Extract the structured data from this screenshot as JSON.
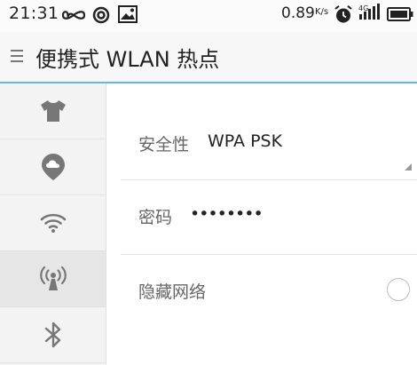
{
  "status_bar": {
    "time": "21:31",
    "speed": "0.89",
    "speed_unit": "K/s",
    "icons": [
      "infinity-icon",
      "sync-icon",
      "image-icon",
      "alarm-icon",
      "signal-4g-icon",
      "battery-icon"
    ],
    "signal_label": "4G"
  },
  "title_bar": {
    "title": "便携式 WLAN 热点",
    "menu_icon": "menu-icon"
  },
  "sidebar": {
    "items": [
      {
        "icon": "shirt-icon",
        "active": false
      },
      {
        "icon": "cloud-location-icon",
        "active": false
      },
      {
        "icon": "wifi-icon",
        "active": false
      },
      {
        "icon": "hotspot-icon",
        "active": true
      },
      {
        "icon": "bluetooth-icon",
        "active": false
      }
    ]
  },
  "settings": {
    "security": {
      "label": "安全性",
      "value": "WPA PSK"
    },
    "password": {
      "label": "密码",
      "value": "••••••••"
    },
    "hidden_network": {
      "label": "隐藏网络",
      "checked": false
    }
  },
  "colors": {
    "accent": "#62b5e5",
    "icon": "#777777",
    "sidebar_bg": "#f3f3f3",
    "sidebar_active_bg": "#e6e6e6"
  }
}
